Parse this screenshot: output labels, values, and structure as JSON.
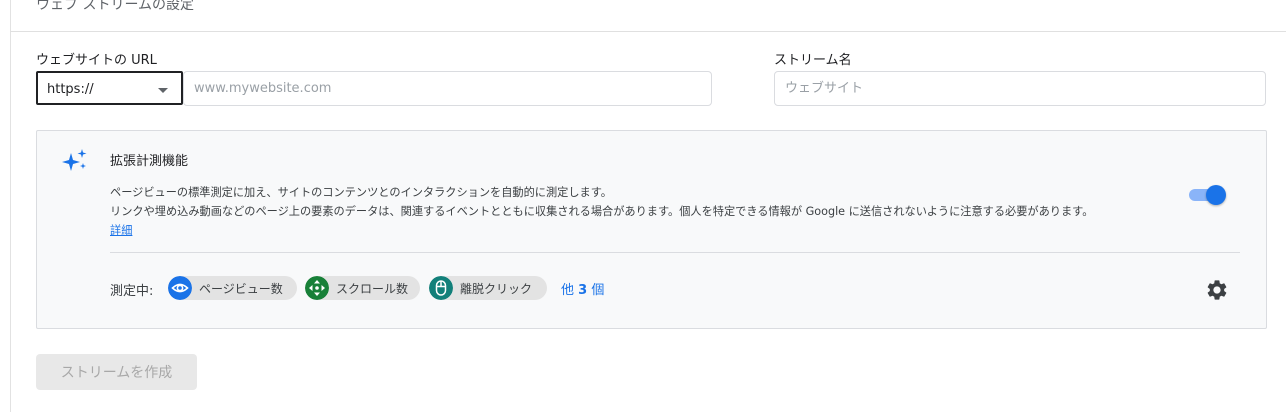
{
  "header": {
    "title": "ウェブ ストリームの設定"
  },
  "form": {
    "url_label": "ウェブサイトの URL",
    "protocol_value": "https://",
    "url_placeholder": "www.mywebsite.com",
    "name_label": "ストリーム名",
    "name_placeholder": "ウェブサイト"
  },
  "enhanced": {
    "title": "拡張計測機能",
    "desc_line1": "ページビューの標準測定に加え、サイトのコンテンツとのインタラクションを自動的に測定します。",
    "desc_line2": "リンクや埋め込み動画などのページ上の要素のデータは、関連するイベントとともに収集される場合があります。個人を特定できる情報が Google に送信されないように注意する必要があります。",
    "details_link": "詳細",
    "toggle_on": true,
    "measuring_label": "測定中:",
    "chips": [
      {
        "label": "ページビュー数",
        "icon": "eye-icon",
        "color": "#1a73e8"
      },
      {
        "label": "スクロール数",
        "icon": "scroll-arrows-icon",
        "color": "#188038"
      },
      {
        "label": "離脱クリック",
        "icon": "mouse-icon",
        "color": "#12807a"
      }
    ],
    "more_prefix": "他",
    "more_count": "3",
    "more_suffix": "個"
  },
  "actions": {
    "create_label": "ストリームを作成"
  },
  "colors": {
    "accent": "#1a73e8",
    "toggle_track": "#8ab4f8",
    "card_bg": "#f8f9fa"
  }
}
